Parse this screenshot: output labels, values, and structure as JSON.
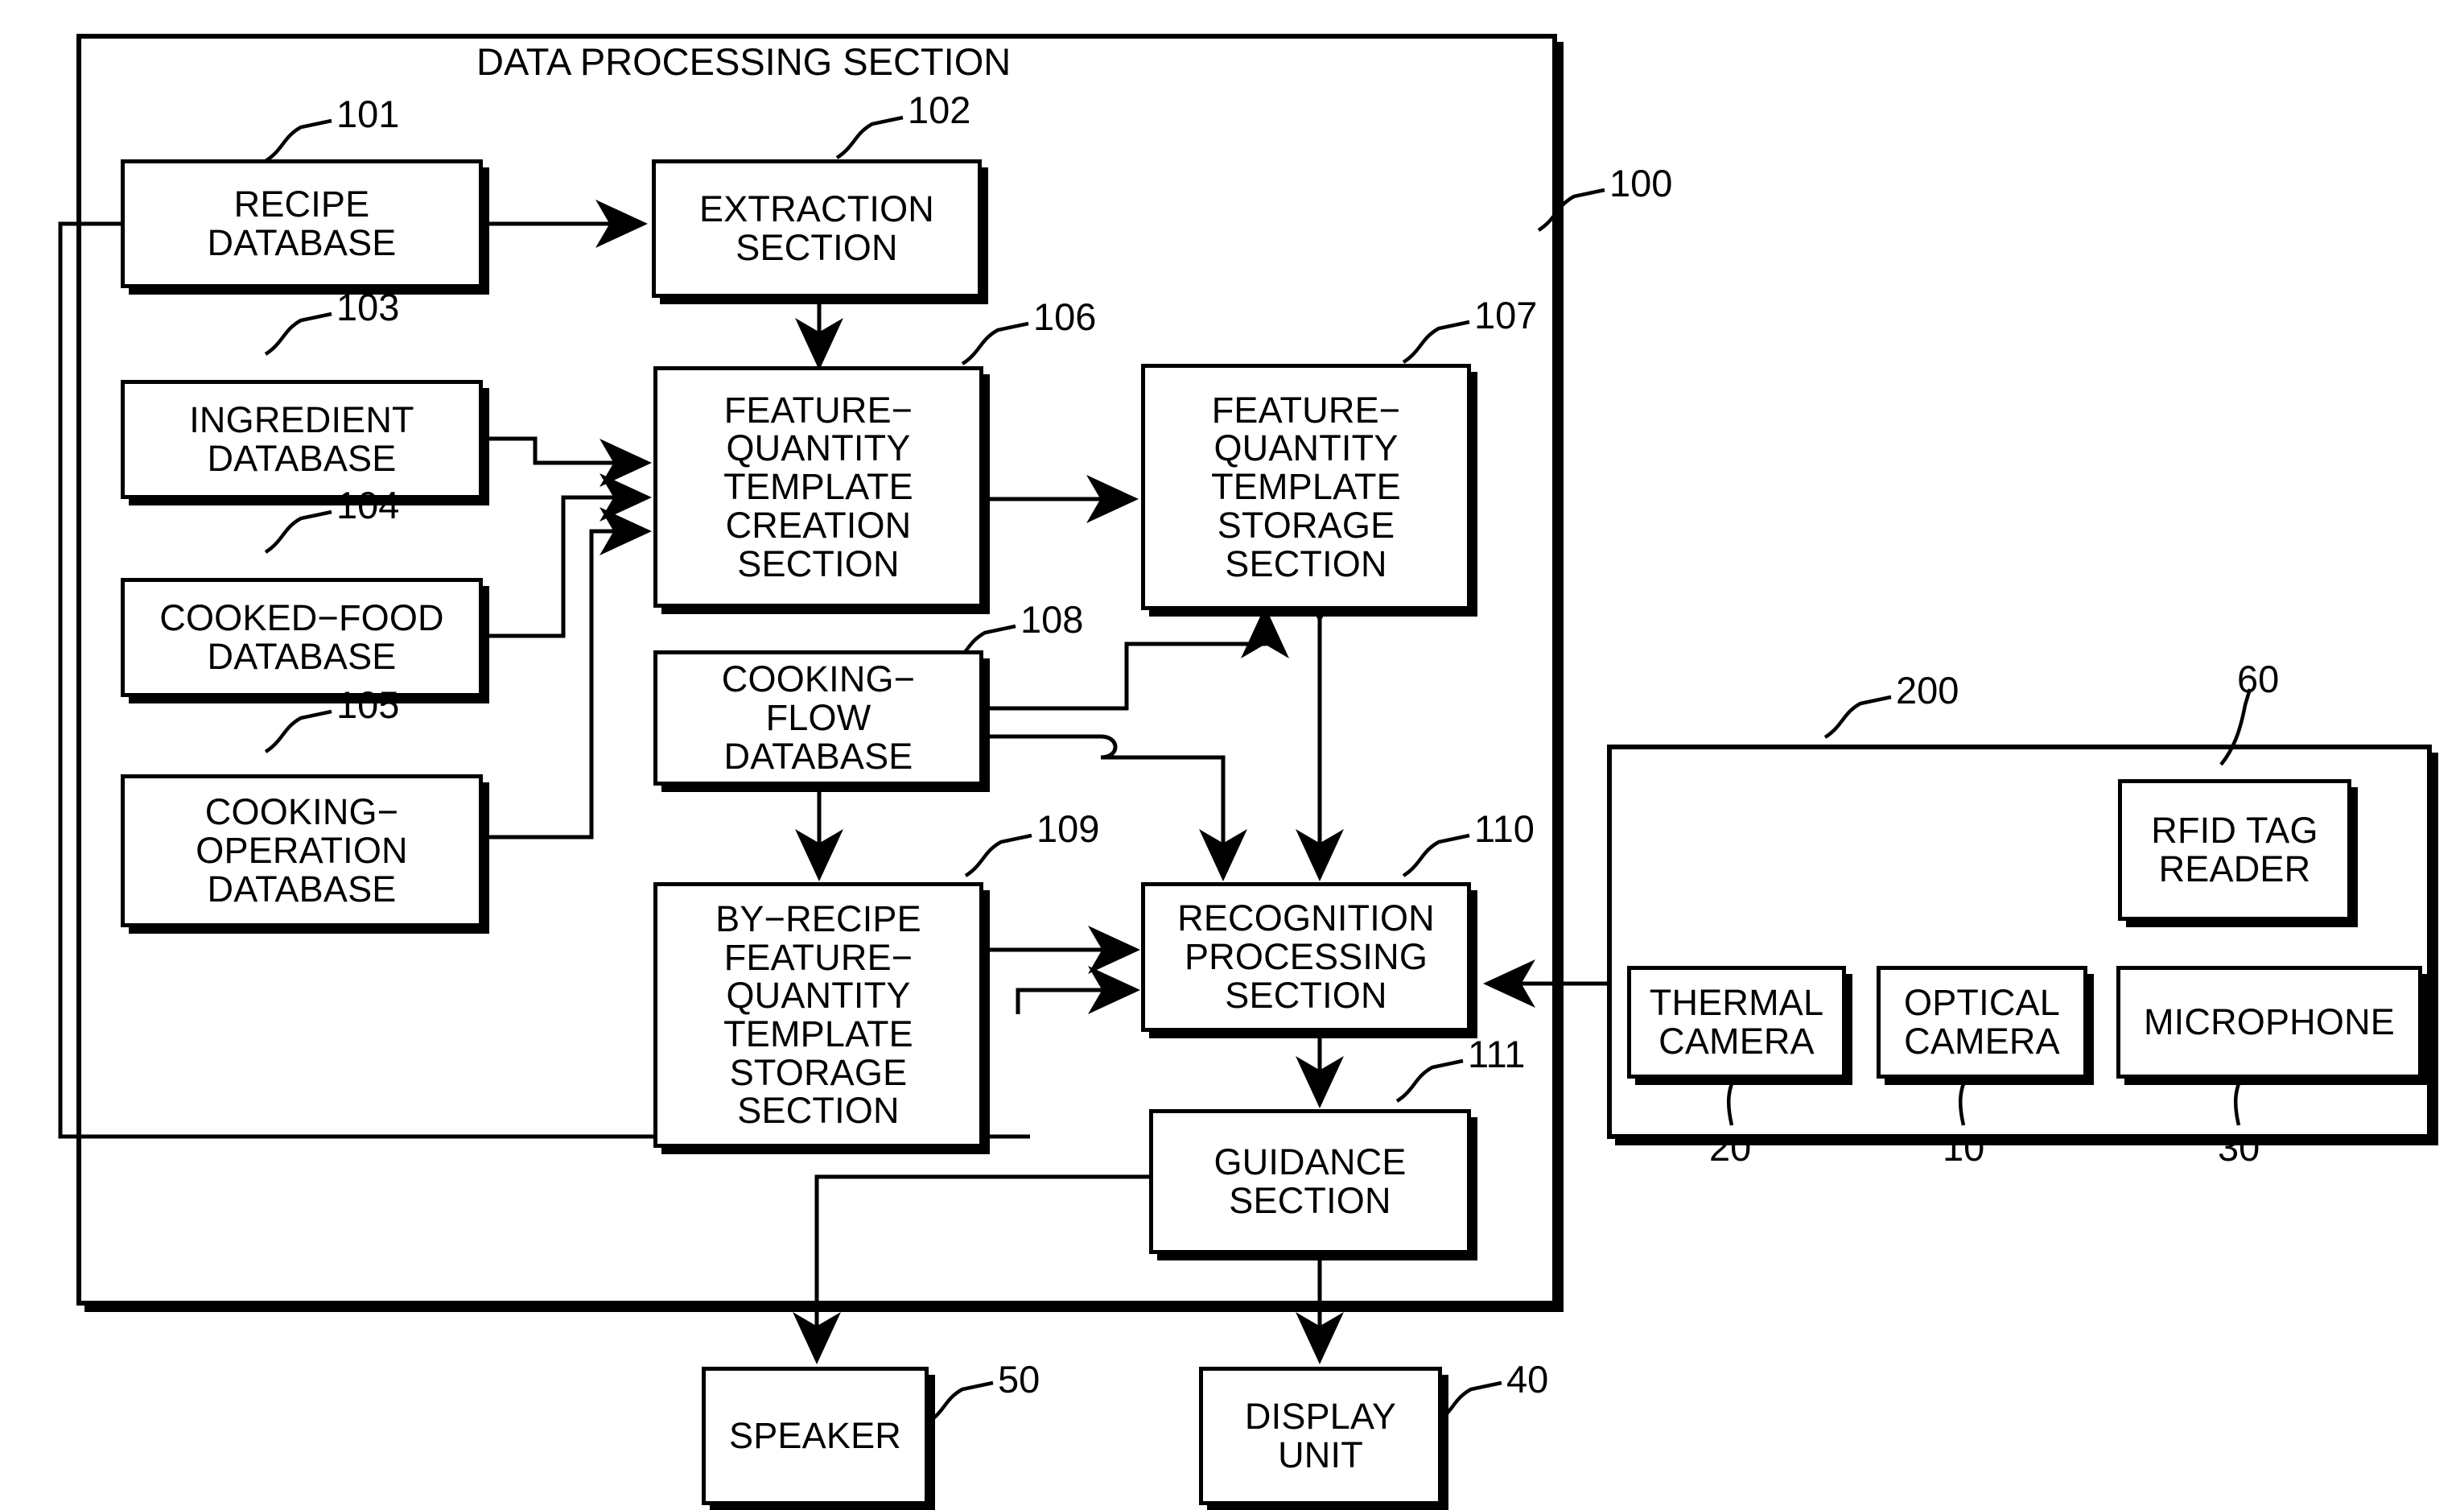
{
  "figure": {
    "title": "DATA PROCESSING SECTION",
    "type": "block-diagram"
  },
  "groups": [
    {
      "id": "data-processing-section",
      "ref": "100",
      "label": "DATA PROCESSING SECTION"
    },
    {
      "id": "sensor-group",
      "ref": "200",
      "label": ""
    }
  ],
  "blocks": [
    {
      "id": "recipe-database",
      "ref": "101",
      "label": "RECIPE\nDATABASE"
    },
    {
      "id": "extraction-section",
      "ref": "102",
      "label": "EXTRACTION\nSECTION"
    },
    {
      "id": "ingredient-database",
      "ref": "103",
      "label": "INGREDIENT\nDATABASE"
    },
    {
      "id": "cooked-food-database",
      "ref": "104",
      "label": "COOKED−FOOD\nDATABASE"
    },
    {
      "id": "cooking-operation-database",
      "ref": "105",
      "label": "COOKING−\nOPERATION\nDATABASE"
    },
    {
      "id": "feature-quantity-template-creation-section",
      "ref": "106",
      "label": "FEATURE−\nQUANTITY\nTEMPLATE\nCREATION\nSECTION"
    },
    {
      "id": "feature-quantity-template-storage-section",
      "ref": "107",
      "label": "FEATURE−\nQUANTITY\nTEMPLATE\nSTORAGE\nSECTION"
    },
    {
      "id": "cooking-flow-database",
      "ref": "108",
      "label": "COOKING−\nFLOW\nDATABASE"
    },
    {
      "id": "by-recipe-feature-quantity-template-storage-section",
      "ref": "109",
      "label": "BY−RECIPE\nFEATURE−\nQUANTITY\nTEMPLATE\nSTORAGE\nSECTION"
    },
    {
      "id": "recognition-processing-section",
      "ref": "110",
      "label": "RECOGNITION\nPROCESSING\nSECTION"
    },
    {
      "id": "guidance-section",
      "ref": "111",
      "label": "GUIDANCE\nSECTION"
    },
    {
      "id": "rfid-tag-reader",
      "ref": "60",
      "label": "RFID TAG\nREADER"
    },
    {
      "id": "thermal-camera",
      "ref": "20",
      "label": "THERMAL\nCAMERA"
    },
    {
      "id": "optical-camera",
      "ref": "10",
      "label": "OPTICAL\nCAMERA"
    },
    {
      "id": "microphone",
      "ref": "30",
      "label": "MICROPHONE"
    },
    {
      "id": "speaker",
      "ref": "50",
      "label": "SPEAKER"
    },
    {
      "id": "display-unit",
      "ref": "40",
      "label": "DISPLAY\nUNIT"
    }
  ],
  "ref_numbers": {
    "r100": "100",
    "r101": "101",
    "r102": "102",
    "r103": "103",
    "r104": "104",
    "r105": "105",
    "r106": "106",
    "r107": "107",
    "r108": "108",
    "r109": "109",
    "r110": "110",
    "r111": "111",
    "r200": "200",
    "r60": "60",
    "r20": "20",
    "r10": "10",
    "r30": "30",
    "r50": "50",
    "r40": "40"
  },
  "colors": {
    "ink": "#000000",
    "paper": "#ffffff"
  }
}
